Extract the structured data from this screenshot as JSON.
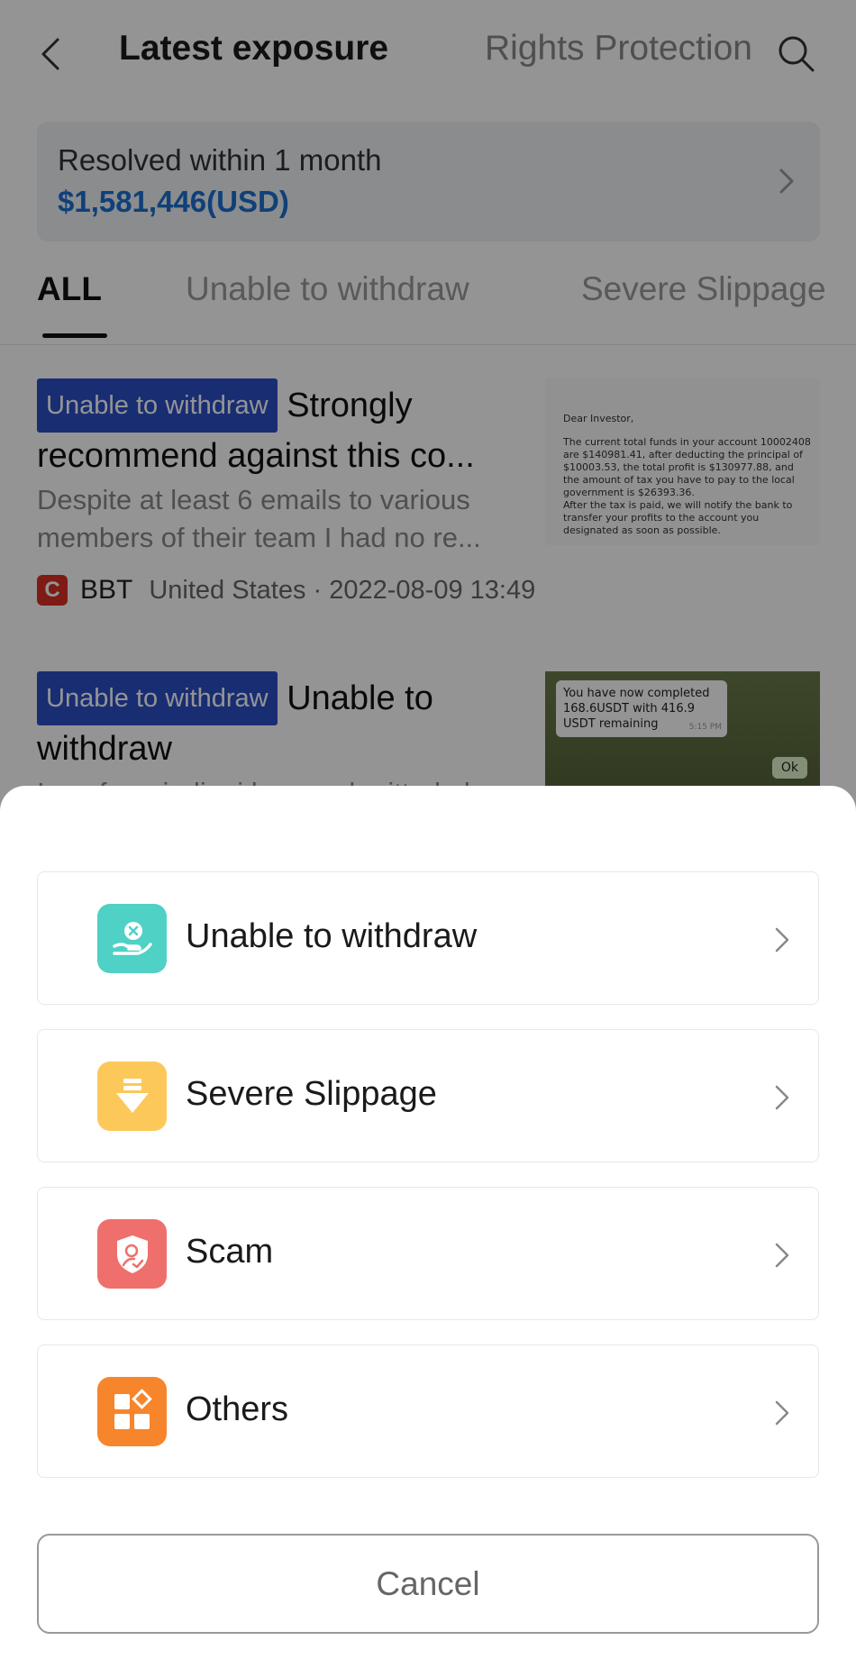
{
  "header": {
    "title": "Latest exposure",
    "secondary_tab": "Rights Protection"
  },
  "summary": {
    "label": "Resolved within 1 month",
    "value": "$1,581,446(USD)"
  },
  "tabs": [
    {
      "label": "ALL",
      "active": true
    },
    {
      "label": "Unable to withdraw",
      "active": false
    },
    {
      "label": "Severe Slippage",
      "active": false
    }
  ],
  "posts": [
    {
      "badge": "Unable to withdraw",
      "title": "Strongly recommend against this co...",
      "excerpt": "Despite at least 6 emails to various members of their team I had no re...",
      "broker_logo_letter": "C",
      "broker": "BBT",
      "country": "United States",
      "datetime": "2022-08-09 13:49",
      "thumbnail": {
        "greeting": "Dear Investor,",
        "paragraph1": "The current total funds in your account 10002408 are $140981.41, after deducting the principal of $10003.53, the total profit is $130977.88, and the amount of tax you have to pay to the local government is $26393.36.",
        "paragraph2": "After the tax is paid, we will notify the bank to transfer your profits to the account you designated as soon as possible."
      }
    },
    {
      "badge": "Unable to withdraw",
      "title": "Unable to withdraw",
      "excerpt": "I am from india, i have submitted al",
      "thumbnail": {
        "message": "You have now completed 168.6USDT with 416.9 USDT remaining",
        "time": "5:15 PM",
        "reply": "Ok"
      }
    }
  ],
  "sheet": {
    "options": [
      {
        "label": "Unable to withdraw",
        "icon": "hand-cross-icon",
        "color": "#4fd1c5"
      },
      {
        "label": "Severe Slippage",
        "icon": "arrow-down-icon",
        "color": "#fcc85a"
      },
      {
        "label": "Scam",
        "icon": "shield-user-icon",
        "color": "#ef6f6c"
      },
      {
        "label": "Others",
        "icon": "grid-diamond-icon",
        "color": "#f7852c"
      }
    ],
    "cancel": "Cancel"
  },
  "colors": {
    "accent_blue": "#1b6fd0",
    "badge_blue": "#2b4fc7",
    "overlay": "rgba(0,0,0,0.42)"
  }
}
